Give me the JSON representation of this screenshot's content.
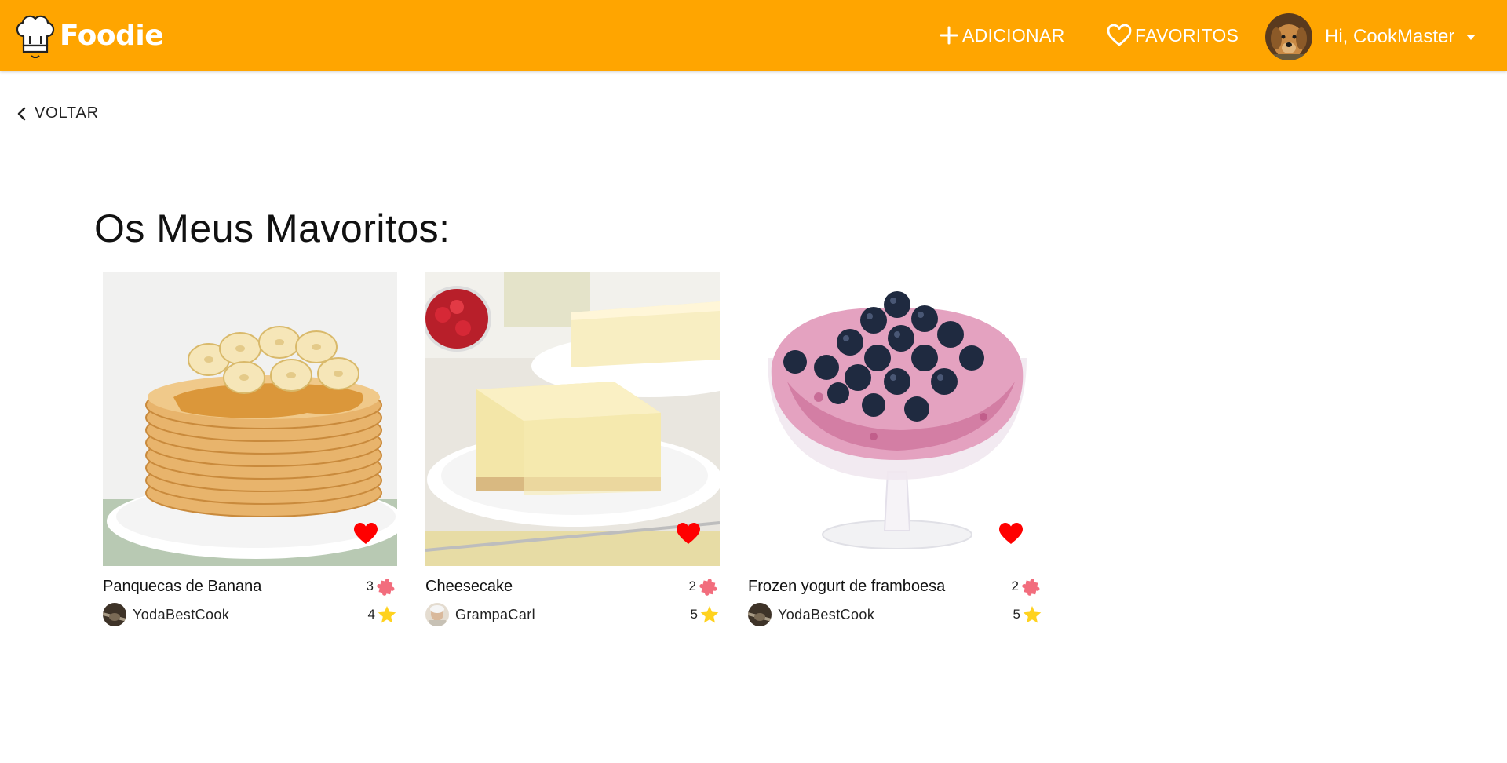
{
  "header": {
    "app_name": "Foodie",
    "add_label": "ADICIONAR",
    "favorites_label": "FAVORITOS",
    "greeting": "Hi, CookMaster",
    "brand_color": "#FFA500"
  },
  "nav": {
    "back_label": "VOLTAR"
  },
  "main": {
    "title": "Os Meus Mavoritos:"
  },
  "recipes": [
    {
      "title": "Panquecas de Banana",
      "author": "YodaBestCook",
      "difficulty": "3",
      "rating": "4",
      "favorited": true
    },
    {
      "title": "Cheesecake",
      "author": "GrampaCarl",
      "difficulty": "2",
      "rating": "5",
      "favorited": true
    },
    {
      "title": "Frozen yogurt de framboesa",
      "author": "YodaBestCook",
      "difficulty": "2",
      "rating": "5",
      "favorited": true
    }
  ],
  "icons": {
    "logo": "chef-hat-icon",
    "add": "plus-icon",
    "favorites": "heart-outline-icon",
    "user_menu": "caret-down-icon",
    "back": "chevron-left-icon",
    "favorite": "heart-filled-icon",
    "difficulty": "puzzle-piece-icon",
    "rating": "star-icon"
  },
  "colors": {
    "heart": "#FF0000",
    "puzzle": "#F26D7D",
    "star": "#FFD21F"
  }
}
